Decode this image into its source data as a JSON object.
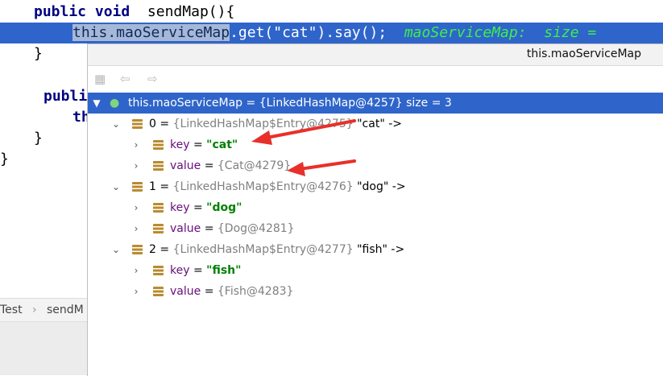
{
  "editor": {
    "line1": {
      "kw1": "public",
      "kw2": "void",
      "method": "sendMap(){"
    },
    "line2": {
      "selected": "this.maoServiceMap",
      "rest": ".get(\"cat\").say();",
      "inline_hint": "maoServiceMap:  size ="
    },
    "line3": "}",
    "line4": "publi",
    "line5": "th",
    "line6": "}",
    "line7": "}"
  },
  "breadcrumb": {
    "item1": "Test",
    "sep": "›",
    "item2": "sendM"
  },
  "popup": {
    "title": "this.maoServiceMap",
    "root": {
      "name": "this.maoServiceMap",
      "eq": " = ",
      "value": "{LinkedHashMap@4257}",
      "size": "size = 3"
    },
    "entries": [
      {
        "index": "0",
        "ref": "{LinkedHashMap$Entry@4275}",
        "label": "\"cat\" ->",
        "key": "\"cat\"",
        "value": "{Cat@4279}"
      },
      {
        "index": "1",
        "ref": "{LinkedHashMap$Entry@4276}",
        "label": "\"dog\" ->",
        "key": "\"dog\"",
        "value": "{Dog@4281}"
      },
      {
        "index": "2",
        "ref": "{LinkedHashMap$Entry@4277}",
        "label": "\"fish\" ->",
        "key": "\"fish\"",
        "value": "{Fish@4283}"
      }
    ],
    "labels": {
      "key": "key",
      "value": "value",
      "eq": " = "
    }
  },
  "colors": {
    "selection": "#2f65ca",
    "string": "#008000",
    "annotation_arrow": "#e8302a"
  }
}
